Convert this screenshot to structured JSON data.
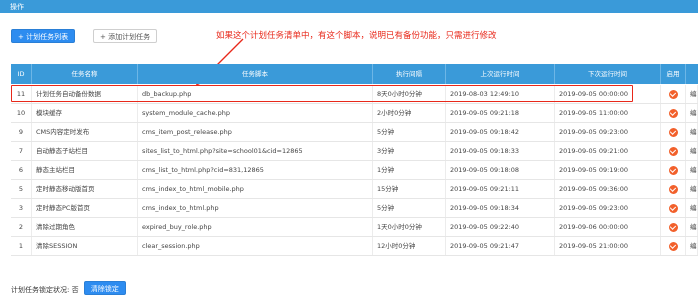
{
  "header": {
    "title": "操作"
  },
  "toolbar": {
    "list_button": "+ 计划任务列表",
    "add_button": "+ 添加计划任务"
  },
  "annotation": "如果这个计划任务清单中，有这个脚本，说明已有备份功能，只需进行修改",
  "table": {
    "columns": [
      "ID",
      "任务名称",
      "任务脚本",
      "执行间隔",
      "上次运行时间",
      "下次运行时间",
      "启用",
      ""
    ],
    "rows": [
      {
        "id": "11",
        "name": "计划任务自动备份数据",
        "script": "db_backup.php",
        "interval": "8天0小时0分钟",
        "last_run": "2019-08-03 12:49:10",
        "next_run": "2019-09-05 00:00:00",
        "action": "编辑"
      },
      {
        "id": "10",
        "name": "模块缓存",
        "script": "system_module_cache.php",
        "interval": "2小时0分钟",
        "last_run": "2019-09-05 09:21:18",
        "next_run": "2019-09-05 11:00:00",
        "action": "编辑"
      },
      {
        "id": "9",
        "name": "CMS内容定时发布",
        "script": "cms_item_post_release.php",
        "interval": "5分钟",
        "last_run": "2019-09-05 09:18:42",
        "next_run": "2019-09-05 09:23:00",
        "action": "编辑"
      },
      {
        "id": "7",
        "name": "自动静态子站栏目",
        "script": "sites_list_to_html.php?site=school01&cid=12865",
        "interval": "3分钟",
        "last_run": "2019-09-05 09:18:33",
        "next_run": "2019-09-05 09:21:00",
        "action": "编辑"
      },
      {
        "id": "6",
        "name": "静态主站栏目",
        "script": "cms_list_to_html.php?cid=831,12865",
        "interval": "1分钟",
        "last_run": "2019-09-05 09:18:08",
        "next_run": "2019-09-05 09:19:00",
        "action": "编辑"
      },
      {
        "id": "5",
        "name": "定时静态移动版首页",
        "script": "cms_index_to_html_mobile.php",
        "interval": "15分钟",
        "last_run": "2019-09-05 09:21:11",
        "next_run": "2019-09-05 09:36:00",
        "action": "编辑"
      },
      {
        "id": "3",
        "name": "定时静态PC版首页",
        "script": "cms_index_to_html.php",
        "interval": "5分钟",
        "last_run": "2019-09-05 09:18:34",
        "next_run": "2019-09-05 09:23:00",
        "action": "编辑"
      },
      {
        "id": "2",
        "name": "清除过期角色",
        "script": "expired_buy_role.php",
        "interval": "1天0小时0分钟",
        "last_run": "2019-09-05 09:22:40",
        "next_run": "2019-09-06 00:00:00",
        "action": "编辑"
      },
      {
        "id": "1",
        "name": "清除SESSION",
        "script": "clear_session.php",
        "interval": "12小时0分钟",
        "last_run": "2019-09-05 09:21:47",
        "next_run": "2019-09-05 21:00:00",
        "action": "编辑"
      }
    ]
  },
  "footer": {
    "lock_status": "计划任务锁定状况: 否",
    "unlock_button": "清除锁定"
  },
  "colors": {
    "header_bg": "#3a9ad9",
    "primary": "#2d8cf0",
    "annotation": "#e8281a",
    "check": "#f2602b"
  }
}
